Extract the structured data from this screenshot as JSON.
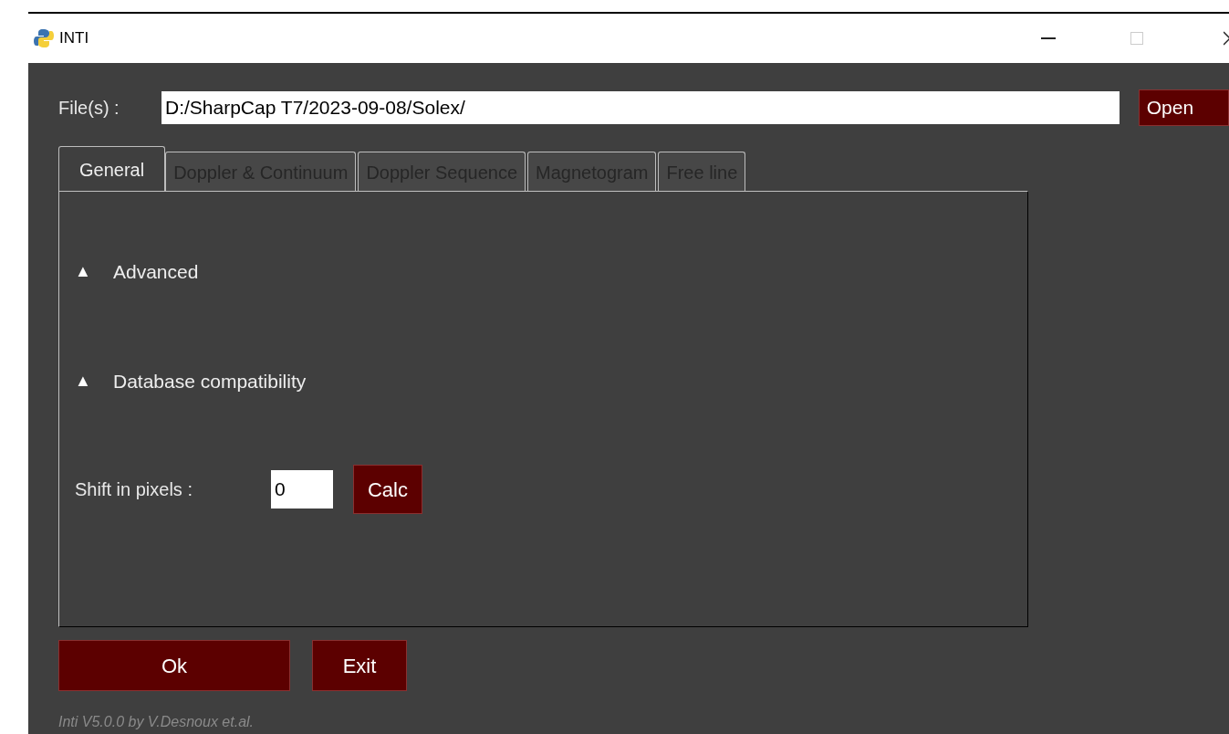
{
  "window": {
    "title": "INTI"
  },
  "file_row": {
    "label": "File(s) :",
    "value": "D:/SharpCap T7/2023-09-08/Solex/",
    "button": "Open"
  },
  "tabs": [
    {
      "label": "General",
      "selected": true
    },
    {
      "label": "Doppler & Continuum",
      "selected": false
    },
    {
      "label": "Doppler Sequence",
      "selected": false
    },
    {
      "label": "Magnetogram",
      "selected": false
    },
    {
      "label": "Free line",
      "selected": false
    }
  ],
  "sections": [
    {
      "symbol": "▲",
      "label": "Advanced"
    },
    {
      "symbol": "▲",
      "label": "Database compatibility"
    }
  ],
  "shift_row": {
    "label": "Shift in pixels :",
    "value": "0",
    "button": "Calc"
  },
  "buttons": [
    {
      "label": "Ok",
      "kind": "wide"
    },
    {
      "label": "Exit",
      "kind": "normal"
    }
  ],
  "footer": "Inti V5.0.0 by V.Desnoux et.al."
}
